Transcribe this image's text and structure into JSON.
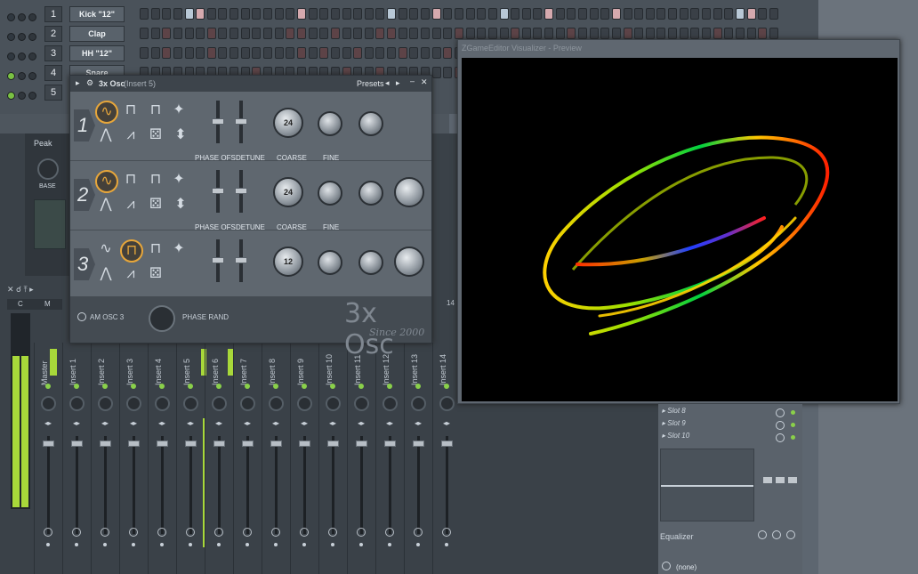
{
  "channel_rack": {
    "rows": [
      {
        "num": "1",
        "name": "Kick \"12\"",
        "led_on": false
      },
      {
        "num": "2",
        "name": "Clap",
        "led_on": false
      },
      {
        "num": "3",
        "name": "HH \"12\"",
        "led_on": false
      },
      {
        "num": "4",
        "name": "Snare",
        "led_on": true
      },
      {
        "num": "5",
        "name": "",
        "led_on": true
      }
    ]
  },
  "mixer": {
    "left_labels": {
      "peak": "Peak",
      "base": "BASE",
      "c": "C",
      "m": "M"
    },
    "strip_number_label": "14",
    "strips": [
      "Master",
      "Insert 1",
      "Insert 2",
      "Insert 3",
      "Insert 4",
      "Insert 5",
      "Insert 6",
      "Insert 7",
      "Insert 8",
      "Insert 9",
      "Insert 10",
      "Insert 11",
      "Insert 12",
      "Insert 13",
      "Insert 14"
    ]
  },
  "osc_window": {
    "title": "3x Osc",
    "title_sub": "(Insert 5)",
    "presets_label": "Presets",
    "rows": [
      {
        "num": "1",
        "coarse_value": "24",
        "selected_wave": "sine"
      },
      {
        "num": "2",
        "coarse_value": "24",
        "selected_wave": "sine"
      },
      {
        "num": "3",
        "coarse_value": "12",
        "selected_wave": "square"
      }
    ],
    "labels": {
      "phase_ofs": "PHASE OFS",
      "detune": "DETUNE",
      "coarse": "COARSE",
      "fine": "FINE",
      "am_osc": "AM OSC 3",
      "phase_rand": "PHASE RAND",
      "brand": "3x Osc",
      "since": "Since 2000"
    }
  },
  "visualizer": {
    "title": "ZGameEditor Visualizer - Preview"
  },
  "fx_panel": {
    "slots": [
      "Slot 8",
      "Slot 9",
      "Slot 10"
    ],
    "equalizer_label": "Equalizer",
    "none_label": "(none)"
  },
  "colors": {
    "accent_orange": "#e7a63a",
    "led_green": "#7ac143",
    "meter_green": "#a8d83a"
  }
}
